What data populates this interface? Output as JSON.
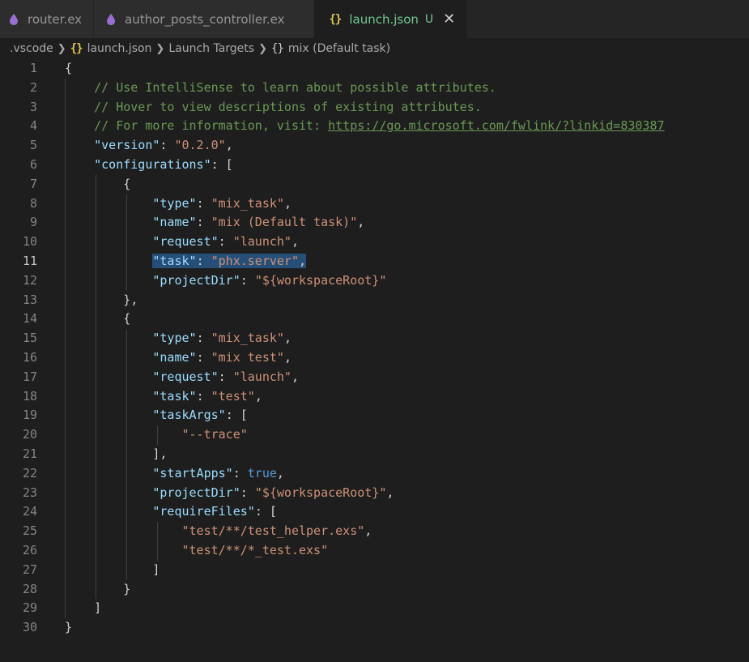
{
  "tabs": [
    {
      "label": "router.ex",
      "icon": "elixir-drop-icon",
      "active": false
    },
    {
      "label": "author_posts_controller.ex",
      "icon": "elixir-drop-icon",
      "active": false
    },
    {
      "label": "launch.json",
      "icon": "json-braces-icon",
      "active": true,
      "status": "U",
      "close": "✕"
    }
  ],
  "breadcrumb": {
    "folder": ".vscode",
    "file": "launch.json",
    "section": "Launch Targets",
    "item": "mix (Default task)",
    "braces": "{}"
  },
  "colors": {
    "key": "#9cdcfe",
    "string": "#ce9178",
    "comment": "#6a9955",
    "boolean": "#569cd6",
    "selection": "#264f78",
    "untracked": "#73c991"
  },
  "editor": {
    "current_line": 11,
    "lines": [
      {
        "n": "1"
      },
      {
        "n": "2"
      },
      {
        "n": "3"
      },
      {
        "n": "4"
      },
      {
        "n": "5"
      },
      {
        "n": "6"
      },
      {
        "n": "7"
      },
      {
        "n": "8"
      },
      {
        "n": "9"
      },
      {
        "n": "10"
      },
      {
        "n": "11"
      },
      {
        "n": "12"
      },
      {
        "n": "13"
      },
      {
        "n": "14"
      },
      {
        "n": "15"
      },
      {
        "n": "16"
      },
      {
        "n": "17"
      },
      {
        "n": "18"
      },
      {
        "n": "19"
      },
      {
        "n": "20"
      },
      {
        "n": "21"
      },
      {
        "n": "22"
      },
      {
        "n": "23"
      },
      {
        "n": "24"
      },
      {
        "n": "25"
      },
      {
        "n": "26"
      },
      {
        "n": "27"
      },
      {
        "n": "28"
      },
      {
        "n": "29"
      },
      {
        "n": "30"
      }
    ],
    "text": {
      "open_brace": "{",
      "comment1": "// Use IntelliSense to learn about possible attributes.",
      "comment2": "// Hover to view descriptions of existing attributes.",
      "comment3_prefix": "// For more information, visit: ",
      "comment3_link": "https://go.microsoft.com/fwlink/?linkid=830387",
      "version_key": "\"version\"",
      "version_val": "\"0.2.0\"",
      "configurations_key": "\"configurations\"",
      "type_key": "\"type\"",
      "name_key": "\"name\"",
      "request_key": "\"request\"",
      "task_key": "\"task\"",
      "projectDir_key": "\"projectDir\"",
      "taskArgs_key": "\"taskArgs\"",
      "startApps_key": "\"startApps\"",
      "requireFiles_key": "\"requireFiles\"",
      "mix_task": "\"mix_task\"",
      "name1": "\"mix (Default task)\"",
      "launch": "\"launch\"",
      "task1": "\"phx.server\"",
      "workspaceRoot": "\"${workspaceRoot}\"",
      "name2": "\"mix test\"",
      "task2": "\"test\"",
      "trace_arg": "\"--trace\"",
      "true_val": "true",
      "require1": "\"test/**/test_helper.exs\"",
      "require2": "\"test/**/*_test.exs\""
    }
  }
}
